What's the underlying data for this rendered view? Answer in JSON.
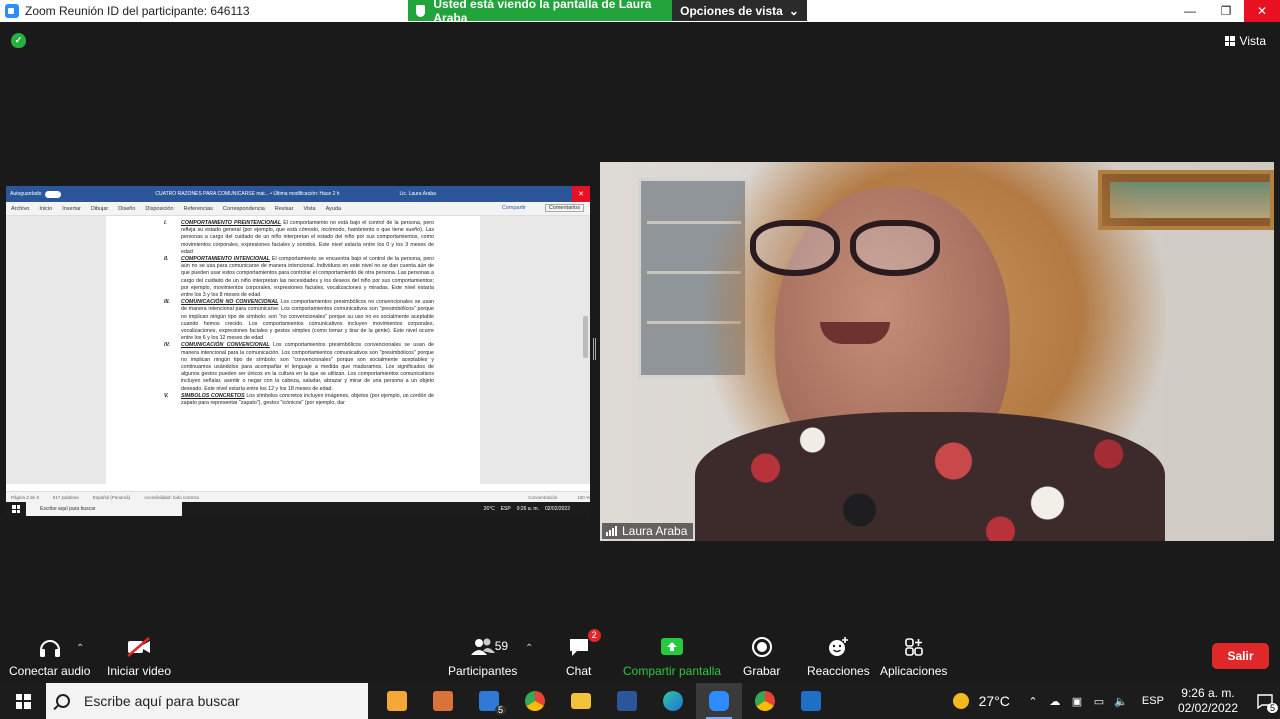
{
  "titlebar": {
    "title": "Zoom Reunión ID del participante: 646113",
    "share_banner": "Usted está viendo la pantalla de Laura Araba",
    "view_options": "Opciones de vista",
    "view_options_caret": "⌄",
    "minimize": "—",
    "restore": "❐",
    "close": "✕"
  },
  "meeting": {
    "vista_label": "Vista",
    "participant_name": "Laura Araba"
  },
  "word": {
    "autosave": "Autoguardado",
    "doc_title": "CUATRO RAZONES PARA COMUNICARSE mat... • Última modificación: Hace 2 h",
    "user": "Lic. Laura Araba",
    "close": "✕",
    "menu": [
      "Archivo",
      "Inicio",
      "Insertar",
      "Dibujar",
      "Diseño",
      "Disposición",
      "Referencias",
      "Correspondencia",
      "Revisar",
      "Vista",
      "Ayuda"
    ],
    "share": "Compartir",
    "comments": "Comentarios",
    "items": [
      {
        "num": "I.",
        "title": "COMPORTAMIENTO PREINTENCIONAL",
        "text": " El comportamiento no está bajo el control de la persona, pero refleja su estado general (por ejemplo, que está cómodo, incómodo, hambriento o que tiene sueño). Las personas a cargo del cuidado de un niño interpretan el estado del niño por sus comportamientos, como movimientos corporales, expresiones faciales y sonidos. Este nivel estaría entre los 0 y los 3 meses de edad"
      },
      {
        "num": "II.",
        "title": "COMPORTAMIENTO INTENCIONAL",
        "text": " El comportamiento se encuentra bajo el control de la persona, pero aún no se usa para comunicarse de manera intencional. Individuos en este nivel no se dan cuenta aún de que pueden usar estos comportamientos para controlar el comportamiento de otra persona. Las personas a cargo del cuidado de un niño interpretan las necesidades y los deseos del niño por sus comportamientos; por ejemplo, movimientos corporales, expresiones faciales, vocalizaciones y miradas. Este nivel estaría entre los 3 y los 8 meses de edad"
      },
      {
        "num": "III.",
        "title": "COMUNICACIÓN NO CONVENCIONAL",
        "text": " Los comportamientos presimbólicos no convencionales se usan de manera intencional para comunicarse. Los comportamientos comunicativos son \"presimbólicos\" porque no implican ningún tipo de símbolo; son \"no convencionales\" porque su uso no es socialmente aceptable cuando hemos crecido. Los comportamientos comunicativos incluyen movimientos corporales, vocalizaciones, expresiones faciales y gestos simples (como tomar y tirar de la gente). Este nivel ocurre entre los 6 y los 12 meses de edad"
      },
      {
        "num": "IV.",
        "title": "COMUNICACIÓN CONVENCIONAL",
        "text": " Los comportamientos presimbólicos convencionales se usan de manera intencional para la comunicación. Los comportamientos comunicativos son \"presimbólicos\" porque no implican ningún tipo de símbolo; son \"convencionales\" porque son socialmente aceptables y continuamos usándolos para acompañar el lenguaje a medida que maduramos. Los significados de algunos gestos pueden ser únicos en la cultura en la que se utilizan. Los comportamientos comunicativos incluyen señalar, asentir o negar con la cabeza, saludar, abrazar y mirar de una persona a un objeto deseado. Este nivel estaría entre los 12 y los 18 meses de edad."
      },
      {
        "num": "V.",
        "title": "SIMBOLOS CONCRETOS",
        "text": " Los símbolos concretos incluyen imágenes, objetos (por ejemplo, un cordón de zapato para representar \"zapato\"), gestos \"icónicos\" (por ejemplo, dar"
      }
    ],
    "status": {
      "page": "Página 2 de 3",
      "words": "617 palabras",
      "lang": "Español (Panamá)",
      "access": "Accesibilidad: todo correcto",
      "focus": "Concentración",
      "zoom": "100 %"
    },
    "taskbar": {
      "search": "Escribe aquí para buscar",
      "temp": "26°C",
      "lang": "ESP",
      "time": "9:26 a. m.",
      "date": "02/02/2022"
    }
  },
  "toolbar": {
    "audio": "Conectar audio",
    "video": "Iniciar video",
    "participants": "Participantes",
    "participants_count": "59",
    "chat": "Chat",
    "chat_badge": "2",
    "share": "Compartir pantalla",
    "record": "Grabar",
    "reactions": "Reacciones",
    "apps": "Aplicaciones",
    "leave": "Salir",
    "caret": "⌃"
  },
  "taskbar": {
    "search": "Escribe aquí para buscar",
    "mail_badge": "5",
    "temp": "27°C",
    "lang": "ESP",
    "time": "9:26 a. m.",
    "date": "02/02/2022",
    "notif_count": "5"
  },
  "colors": {
    "zoom_green": "#23a33b",
    "leave_red": "#e02828",
    "word_blue": "#2b579a"
  }
}
